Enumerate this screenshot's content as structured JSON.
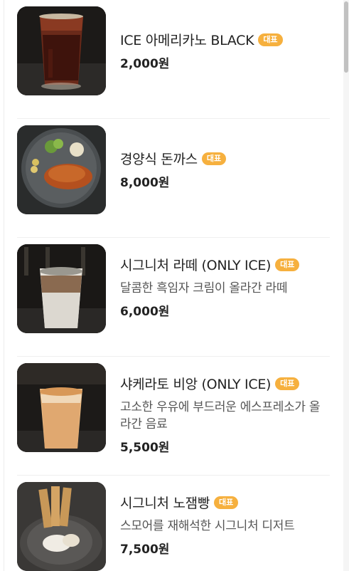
{
  "menu": {
    "items": [
      {
        "name": "ICE 아메리카노 BLACK",
        "badge": "대표",
        "description": "",
        "price": "2,000원",
        "image": "iced-americano-photo"
      },
      {
        "name": "경양식 돈까스",
        "badge": "대표",
        "description": "",
        "price": "8,000원",
        "image": "pork-cutlet-photo"
      },
      {
        "name": "시그니처 라떼 (ONLY ICE)",
        "badge": "대표",
        "description": "달콤한 흑임자 크림이 올라간 라떼",
        "price": "6,000원",
        "image": "signature-latte-photo"
      },
      {
        "name": "샤케라토 비앙 (ONLY ICE)",
        "badge": "대표",
        "description": "고소한 우유에 부드러운 에스프레소가 올라간 음료",
        "price": "5,500원",
        "image": "shakerato-bianco-photo"
      },
      {
        "name": "시그니처 노잼빵",
        "badge": "대표",
        "description": "스모어를 재해석한 시그니처 디저트",
        "price": "7,500원",
        "image": "signature-nojam-bread-photo"
      }
    ]
  },
  "colors": {
    "badge_bg": "#f6b03e",
    "text_primary": "#222222",
    "text_secondary": "#555555",
    "divider": "#efefef"
  }
}
